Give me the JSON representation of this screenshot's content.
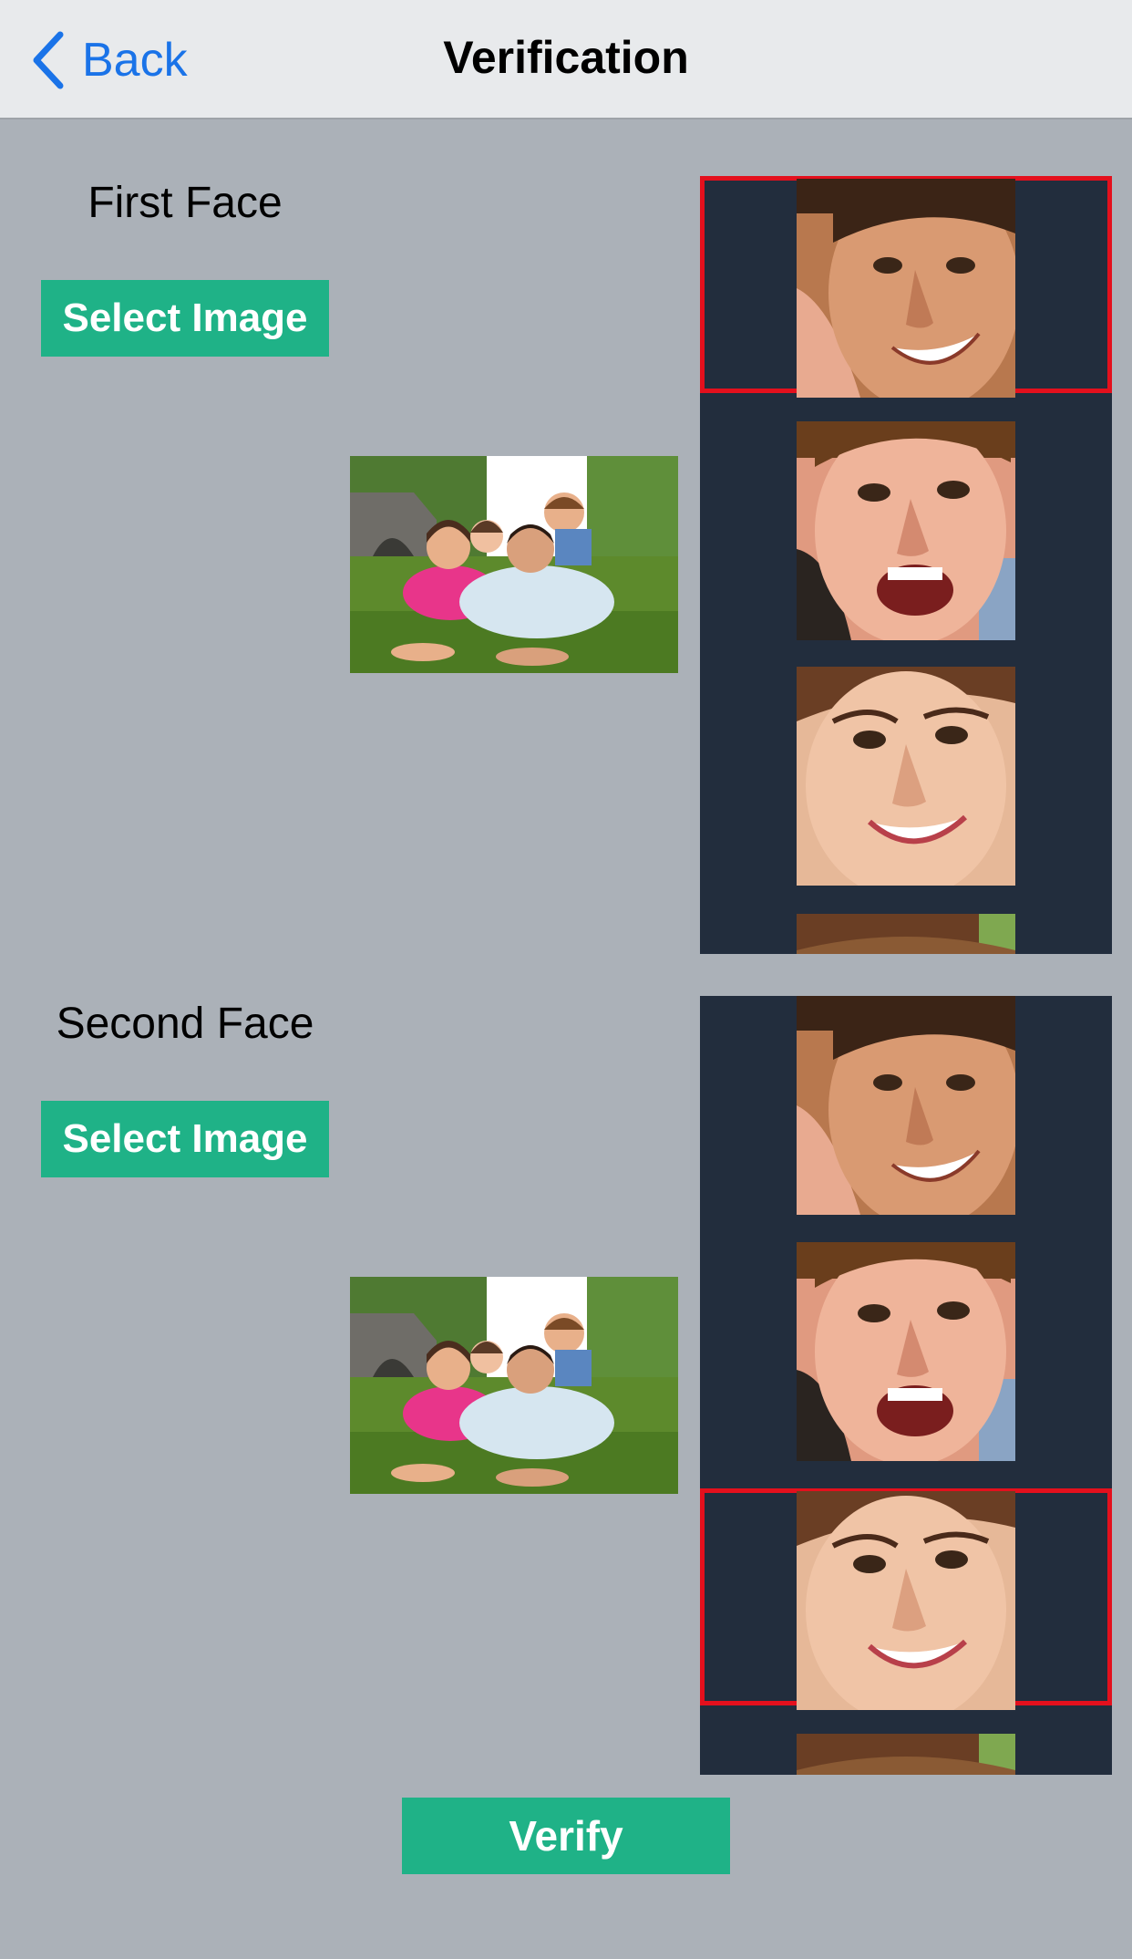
{
  "navbar": {
    "back_label": "Back",
    "title": "Verification"
  },
  "first_face": {
    "title": "First Face",
    "select_button": "Select Image",
    "selected_face_index": 0,
    "faces": [
      "man-face",
      "boy-face",
      "woman-face",
      "girl-face"
    ]
  },
  "second_face": {
    "title": "Second Face",
    "select_button": "Select Image",
    "selected_face_index": 2,
    "faces": [
      "man-face",
      "boy-face",
      "woman-face",
      "girl-face"
    ]
  },
  "verify_button": "Verify",
  "colors": {
    "accent_green": "#1fb287",
    "link_blue": "#1a73e8",
    "selection_red": "#e4101d",
    "face_list_bg": "#222d3d",
    "background": "#abb1b8"
  }
}
